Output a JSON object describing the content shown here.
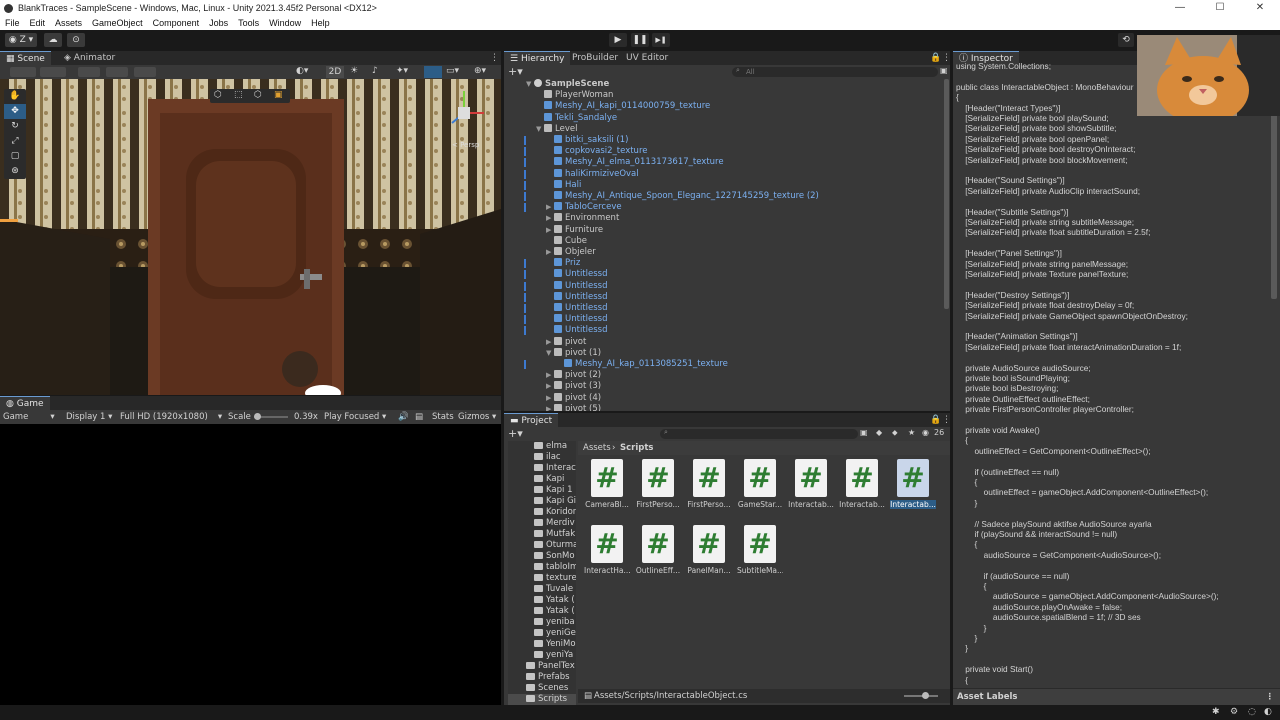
{
  "window": {
    "title": "BlankTraces - SampleScene - Windows, Mac, Linux - Unity 2021.3.45f2 Personal <DX12>",
    "minimize": "—",
    "maximize": "☐",
    "close": "✕"
  },
  "menu": [
    "File",
    "Edit",
    "Assets",
    "GameObject",
    "Component",
    "Jobs",
    "Tools",
    "Window",
    "Help"
  ],
  "toolbar": {
    "account": "Z",
    "play": "▶",
    "pause": "❚❚",
    "step": "▶❚"
  },
  "scene": {
    "tabs": [
      "Scene",
      "Animator"
    ],
    "mode_2d": "2D",
    "persp_label": "< Persp"
  },
  "game": {
    "tab": "Game",
    "view": "Game",
    "display": "Display 1",
    "resolution": "Full HD (1920x1080)",
    "scale_label": "Scale",
    "scale_value": "0.39x",
    "play_focused": "Play Focused",
    "stats": "Stats",
    "gizmos": "Gizmos"
  },
  "hierarchy": {
    "tabs": [
      "Hierarchy",
      "ProBuilder",
      "UV Editor"
    ],
    "search_placeholder": "All",
    "rows": [
      {
        "label": "SampleScene",
        "indent": 0,
        "color": "grey",
        "tri": "▼",
        "scene": true
      },
      {
        "label": "PlayerWoman",
        "indent": 1,
        "color": "grey",
        "tri": ""
      },
      {
        "label": "Meshy_AI_kapi_0114000759_texture",
        "indent": 1,
        "color": "blue",
        "tri": ""
      },
      {
        "label": "Tekli_Sandalye",
        "indent": 1,
        "color": "blue",
        "tri": ""
      },
      {
        "label": "Level",
        "indent": 1,
        "color": "grey",
        "tri": "▼"
      },
      {
        "label": "bitki_saksili (1)",
        "indent": 2,
        "color": "blue",
        "tri": ""
      },
      {
        "label": "copkovasi2_texture",
        "indent": 2,
        "color": "blue",
        "tri": ""
      },
      {
        "label": "Meshy_AI_elma_0113173617_texture",
        "indent": 2,
        "color": "blue",
        "tri": ""
      },
      {
        "label": "haliKirmiziveOval",
        "indent": 2,
        "color": "blue",
        "tri": ""
      },
      {
        "label": "Hali",
        "indent": 2,
        "color": "blue",
        "tri": ""
      },
      {
        "label": "Meshy_AI_Antique_Spoon_Eleganc_1227145259_texture (2)",
        "indent": 2,
        "color": "blue",
        "tri": ""
      },
      {
        "label": "TabloCerceve",
        "indent": 2,
        "color": "blue",
        "tri": "▶"
      },
      {
        "label": "Environment",
        "indent": 2,
        "color": "grey",
        "tri": "▶"
      },
      {
        "label": "Furniture",
        "indent": 2,
        "color": "grey",
        "tri": "▶"
      },
      {
        "label": "Cube",
        "indent": 2,
        "color": "grey",
        "tri": ""
      },
      {
        "label": "Objeler",
        "indent": 2,
        "color": "grey",
        "tri": "▶"
      },
      {
        "label": "Priz",
        "indent": 2,
        "color": "blue",
        "tri": ""
      },
      {
        "label": "Untitlessd",
        "indent": 2,
        "color": "blue",
        "tri": ""
      },
      {
        "label": "Untitlessd",
        "indent": 2,
        "color": "blue",
        "tri": ""
      },
      {
        "label": "Untitlessd",
        "indent": 2,
        "color": "blue",
        "tri": ""
      },
      {
        "label": "Untitlessd",
        "indent": 2,
        "color": "blue",
        "tri": ""
      },
      {
        "label": "Untitlessd",
        "indent": 2,
        "color": "blue",
        "tri": ""
      },
      {
        "label": "Untitlessd",
        "indent": 2,
        "color": "blue",
        "tri": ""
      },
      {
        "label": "pivot",
        "indent": 2,
        "color": "grey",
        "tri": "▶"
      },
      {
        "label": "pivot (1)",
        "indent": 2,
        "color": "grey",
        "tri": "▼"
      },
      {
        "label": "Meshy_AI_kap_0113085251_texture",
        "indent": 3,
        "color": "blue",
        "tri": ""
      },
      {
        "label": "pivot (2)",
        "indent": 2,
        "color": "grey",
        "tri": "▶"
      },
      {
        "label": "pivot (3)",
        "indent": 2,
        "color": "grey",
        "tri": "▶"
      },
      {
        "label": "pivot (4)",
        "indent": 2,
        "color": "grey",
        "tri": "▶"
      },
      {
        "label": "pivot (5)",
        "indent": 2,
        "color": "grey",
        "tri": "▶"
      }
    ]
  },
  "project": {
    "tab": "Project",
    "count": "26",
    "breadcrumb_root": "Assets",
    "breadcrumb_sep": "›",
    "breadcrumb_current": "Scripts",
    "folders": [
      "elma",
      "ilac",
      "Interac",
      "Kapi",
      "Kapi 1",
      "Kapi Gi",
      "Koridor",
      "Merdiv",
      "Mutfak",
      "Oturma",
      "SonMo",
      "tabloIm",
      "texture",
      "Tuvale",
      "Yatak (",
      "Yatak (",
      "yeniba",
      "yeniGe",
      "YeniMo",
      "yeniYa",
      "PanelTex",
      "Prefabs",
      "Scenes",
      "Scripts"
    ],
    "scripts": [
      "CameraBl...",
      "FirstPerso...",
      "FirstPerso...",
      "GameStar...",
      "Interactab...",
      "Interactab...",
      "Interactab...",
      "InteractHa...",
      "OutlineEff...",
      "PanelMan...",
      "SubtitleMa..."
    ],
    "script_glyph": "#",
    "footer_path": "Assets/Scripts/InteractableObject.cs"
  },
  "inspector": {
    "tab": "Inspector",
    "asset_labels": "Asset Labels",
    "code": [
      "using System.Collections;",
      "",
      "public class InteractableObject : MonoBehaviour",
      "{",
      "    [Header(\"Interact Types\")]",
      "    [SerializeField] private bool playSound;",
      "    [SerializeField] private bool showSubtitle;",
      "    [SerializeField] private bool openPanel;",
      "    [SerializeField] private bool destroyOnInteract;",
      "    [SerializeField] private bool blockMovement;",
      "",
      "    [Header(\"Sound Settings\")]",
      "    [SerializeField] private AudioClip interactSound;",
      "",
      "    [Header(\"Subtitle Settings\")]",
      "    [SerializeField] private string subtitleMessage;",
      "    [SerializeField] private float subtitleDuration = 2.5f;",
      "",
      "    [Header(\"Panel Settings\")]",
      "    [SerializeField] private string panelMessage;",
      "    [SerializeField] private Texture panelTexture;",
      "",
      "    [Header(\"Destroy Settings\")]",
      "    [SerializeField] private float destroyDelay = 0f;",
      "    [SerializeField] private GameObject spawnObjectOnDestroy;",
      "",
      "    [Header(\"Animation Settings\")]",
      "    [SerializeField] private float interactAnimationDuration = 1f;",
      "",
      "    private AudioSource audioSource;",
      "    private bool isSoundPlaying;",
      "    private bool isDestroying;",
      "    private OutlineEffect outlineEffect;",
      "    private FirstPersonController playerController;",
      "",
      "    private void Awake()",
      "    {",
      "        outlineEffect = GetComponent<OutlineEffect>();",
      "",
      "        if (outlineEffect == null)",
      "        {",
      "            outlineEffect = gameObject.AddComponent<OutlineEffect>();",
      "        }",
      "",
      "        // Sadece playSound aktifse AudioSource ayarla",
      "        if (playSound && interactSound != null)",
      "        {",
      "            audioSource = GetComponent<AudioSource>();",
      "",
      "            if (audioSource == null)",
      "            {",
      "                audioSource = gameObject.AddComponent<AudioSource>();",
      "                audioSource.playOnAwake = false;",
      "                audioSource.spatialBlend = 1f; // 3D ses",
      "            }",
      "        }",
      "    }",
      "",
      "    private void Start()",
      "    {"
    ]
  },
  "colors": {
    "accent": "#2c5d87",
    "blue_text": "#7cb1f2",
    "panel": "#383838",
    "script_hash": "#2e7d32"
  }
}
